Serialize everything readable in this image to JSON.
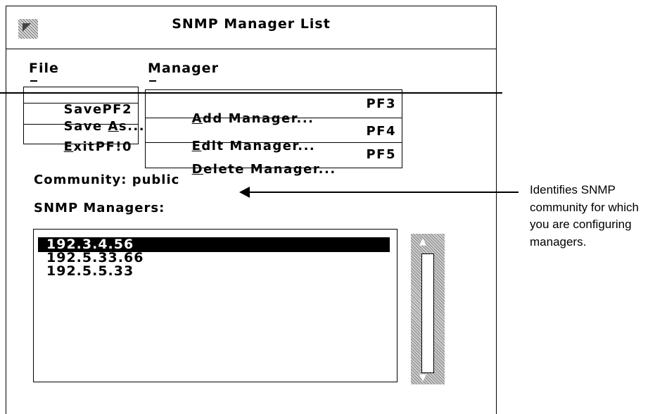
{
  "window": {
    "title": "SNMP Manager List"
  },
  "menubar": {
    "file": "File",
    "manager": "Manager"
  },
  "file_menu": {
    "items": [
      {
        "label": "Save",
        "accel": "PF2"
      },
      {
        "label": "Save As...",
        "accel": ""
      },
      {
        "label": "Exit",
        "accel": "PF!0"
      }
    ]
  },
  "manager_menu": {
    "items": [
      {
        "label": "Add Manager...",
        "accel": "PF3"
      },
      {
        "label": "Edit Manager...",
        "accel": "PF4"
      },
      {
        "label": "Delete Manager...",
        "accel": "PF5"
      }
    ]
  },
  "community_label": "Community: public",
  "managers_label": "SNMP Managers:",
  "managers": [
    "192.3.4.56",
    "192.5.33.66",
    "192.5.5.33"
  ],
  "selected_manager": "192.3.4.56",
  "callout": {
    "text": "Identifies SNMP community for which you are configuring managers."
  }
}
